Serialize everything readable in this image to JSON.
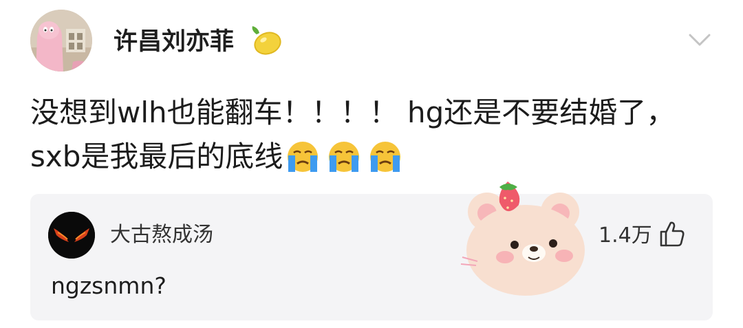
{
  "post": {
    "author_name": "许昌刘亦菲",
    "author_emoji": "lemon-emoji",
    "text_line1": "没想到wlh也能翻车！！！！ hg还是不要结婚了，",
    "text_line2": "sxb是我最后的底线",
    "trailing_emojis": [
      "crying-face-emoji",
      "crying-face-emoji",
      "crying-face-emoji"
    ],
    "more_icon": "chevron-down-icon"
  },
  "reply": {
    "author_name": "大古熬成汤",
    "text": "ngzsnmn?",
    "like_count": "1.4万",
    "like_icon": "thumbs-up-icon"
  },
  "colors": {
    "reply_background": "#f4f4f6",
    "lemon": "#f3d23c",
    "crying_face": "#f6c439",
    "tears": "#3e9bf0"
  }
}
